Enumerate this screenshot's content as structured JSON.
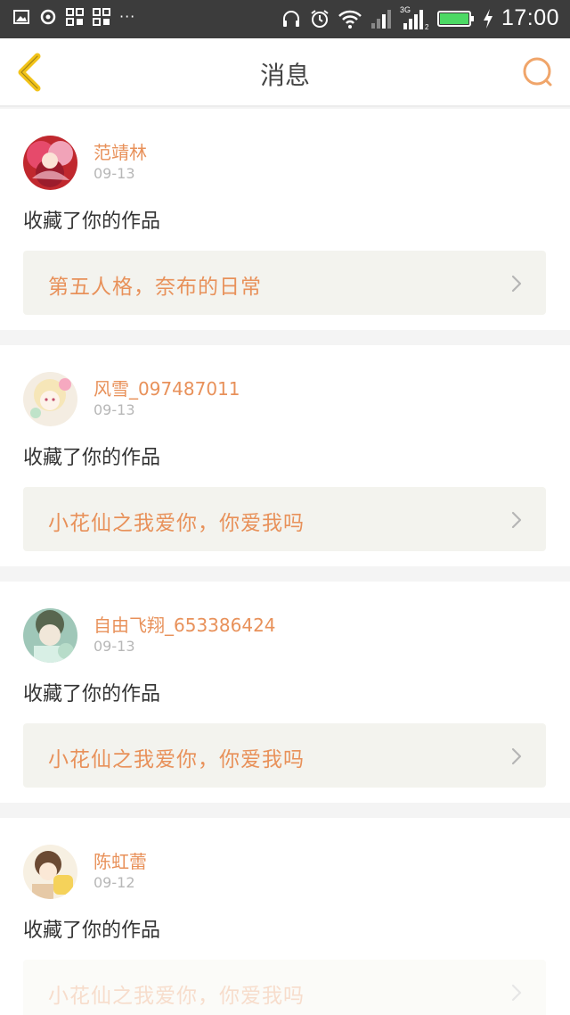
{
  "status_bar": {
    "time": "17:00",
    "network_label": "3G",
    "colors": {
      "background": "#3c3c3c",
      "battery": "#4cd964"
    },
    "left_icons": [
      "image-icon",
      "sync-icon",
      "app-grid-icon",
      "app-grid-icon",
      "more-dots-icon"
    ],
    "right_icons": [
      "headphones-icon",
      "alarm-icon",
      "wifi-icon",
      "signal-icon",
      "signal-3g-icon",
      "battery-icon",
      "charging-icon"
    ]
  },
  "header": {
    "title": "消息",
    "back_icon": "chevron-left-icon",
    "search_icon": "search-icon",
    "colors": {
      "back": "#f2c318",
      "search": "#f0a56a"
    }
  },
  "messages": [
    {
      "username": "范靖林",
      "date": "09-13",
      "action": "收藏了你的作品",
      "work_title": "第五人格，奈布的日常"
    },
    {
      "username": "风雪_097487011",
      "date": "09-13",
      "action": "收藏了你的作品",
      "work_title": "小花仙之我爱你，你爱我吗"
    },
    {
      "username": "自由飞翔_653386424",
      "date": "09-13",
      "action": "收藏了你的作品",
      "work_title": "小花仙之我爱你，你爱我吗"
    },
    {
      "username": "陈虹蕾",
      "date": "09-12",
      "action": "收藏了你的作品",
      "work_title": "小花仙之我爱你，你爱我吗"
    }
  ],
  "colors": {
    "accent": "#e8915a",
    "date": "#b7b7b7",
    "link_bg": "#f3f3ee"
  }
}
